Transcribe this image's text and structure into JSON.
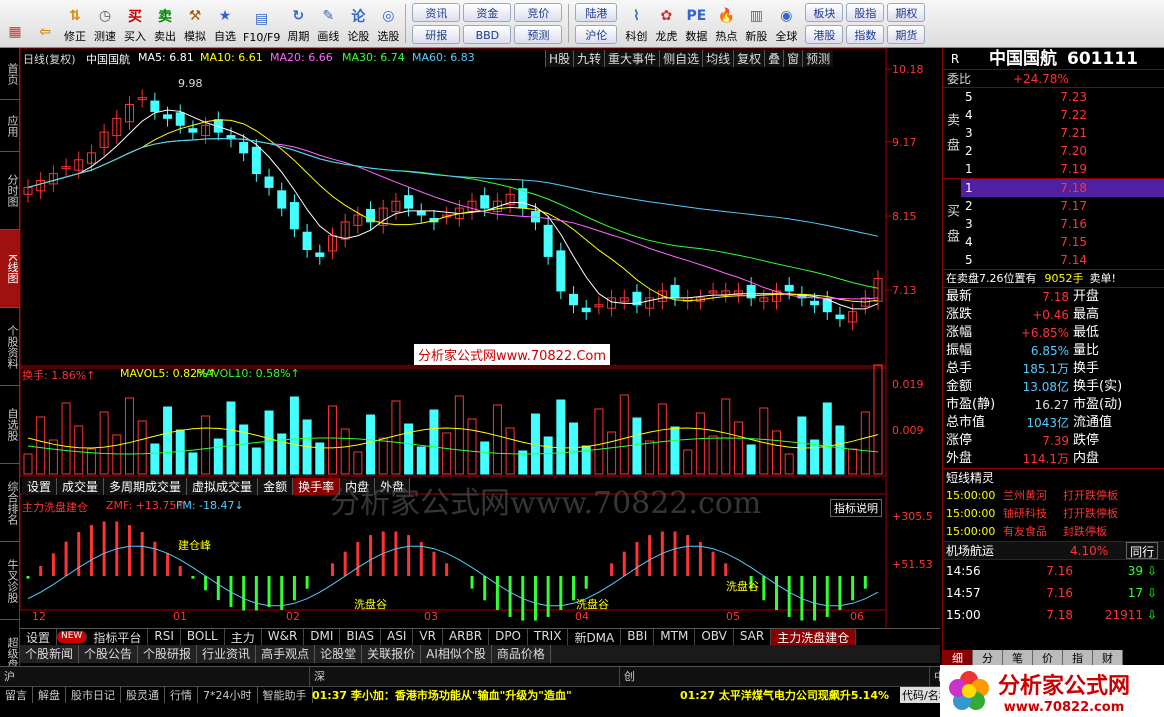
{
  "toolbar": {
    "buttons": [
      {
        "label": "",
        "icon": "grid-icon",
        "color": "#c33"
      },
      {
        "label": "",
        "icon": "back-arrow-icon",
        "color": "#d80"
      },
      {
        "label": "修正",
        "icon": "up-down-icon",
        "color": "#d80"
      },
      {
        "label": "测速",
        "icon": "clock-icon",
        "color": "#555"
      },
      {
        "label": "买入",
        "icon": "buy-icon",
        "color": "#c00"
      },
      {
        "label": "卖出",
        "icon": "sell-icon",
        "color": "#080"
      },
      {
        "label": "模拟",
        "icon": "hammer-icon",
        "color": "#a50"
      },
      {
        "label": "自选",
        "icon": "star-icon",
        "color": "#36c"
      },
      {
        "label": "F10/F9",
        "icon": "f10-icon",
        "color": "#36c"
      },
      {
        "label": "周期",
        "icon": "cycle-icon",
        "color": "#36c"
      },
      {
        "label": "画线",
        "icon": "pen-icon",
        "color": "#36c"
      },
      {
        "label": "论股",
        "icon": "discuss-icon",
        "color": "#36c"
      },
      {
        "label": "选股",
        "icon": "select-icon",
        "color": "#36c"
      }
    ],
    "pills1": [
      "资讯",
      "资金",
      "竞价",
      "研报",
      "BBD",
      "预测"
    ],
    "pills2": [
      "陆港",
      "沪伦"
    ],
    "buttons2": [
      {
        "label": "科创",
        "icon": "chart-icon",
        "color": "#36c"
      },
      {
        "label": "龙虎",
        "icon": "dragon-icon",
        "color": "#c33"
      },
      {
        "label": "数据",
        "icon": "pe-icon",
        "color": "#36c"
      },
      {
        "label": "热点",
        "icon": "hot-icon",
        "color": "#c33"
      },
      {
        "label": "新股",
        "icon": "ipo-icon",
        "color": "#36c"
      },
      {
        "label": "全球",
        "icon": "globe-icon",
        "color": "#36c"
      }
    ],
    "pills3": [
      "板块",
      "股指",
      "期权",
      "港股",
      "指数",
      "期货"
    ]
  },
  "left_tabs": [
    {
      "label": "首页",
      "active": false
    },
    {
      "label": "应用",
      "active": false
    },
    {
      "label": "分时图",
      "active": false
    },
    {
      "label": "K线图",
      "active": true
    },
    {
      "label": "个股资料",
      "active": false
    },
    {
      "label": "自选股",
      "active": false
    },
    {
      "label": "综合排名",
      "active": false
    },
    {
      "label": "牛叉诊股",
      "active": false
    },
    {
      "label": "超级盘口",
      "active": false
    }
  ],
  "chart": {
    "header": {
      "period": "日线(复权)",
      "name": "中国国航",
      "ma5": "MA5: 6.81",
      "ma10": "MA10: 6.61",
      "ma20": "MA20: 6.66",
      "ma30": "MA30: 6.74",
      "ma60": "MA60: 6.83"
    },
    "top_tabs": [
      "H股",
      "九转",
      "重大事件",
      "侧自选",
      "均线",
      "复权",
      "叠",
      "窗",
      "预测"
    ],
    "price_axis": [
      "10.18",
      "9.17",
      "8.15",
      "7.13"
    ],
    "high_mark": "9.98",
    "low_mark": "6.25",
    "watermark_center": "分析家公式网www.70822.Com",
    "vol_header": {
      "a": "换手: 1.86%↑",
      "b": "MAVOL5: 0.82%↑",
      "c": "MAVOL10: 0.58%↑"
    },
    "vol_axis": [
      "0.019",
      "0.009"
    ],
    "vol_tabs": [
      "设置",
      "成交量",
      "多周期成交量",
      "虚拟成交量",
      "金额",
      "换手率",
      "内盘",
      "外盘"
    ],
    "vol_tab_active": "换手率",
    "ind_header": {
      "name": "主力洗盘建仓",
      "zmf": "ZMF: +13.75↑",
      "fm": "FM: -18.47↓",
      "help": "指标说明"
    },
    "ind_axis": [
      "+305.5",
      "+51.53"
    ],
    "ind_labels": {
      "peak": "建仓峰",
      "valley1": "洗盘谷",
      "valley2": "洗盘谷",
      "valley3": "洗盘谷"
    },
    "watermark_big": "分析家公式网www.70822.com",
    "months": [
      "12",
      "01",
      "02",
      "03",
      "04",
      "05",
      "06"
    ]
  },
  "chart_data": {
    "type": "candlestick",
    "price_range": [
      6.0,
      10.2
    ],
    "close": [
      8.5,
      8.6,
      8.7,
      8.8,
      8.9,
      9.0,
      9.3,
      9.5,
      9.7,
      9.8,
      9.6,
      9.5,
      9.4,
      9.3,
      9.4,
      9.3,
      9.2,
      9.0,
      8.7,
      8.5,
      8.2,
      7.9,
      7.6,
      7.5,
      7.8,
      8.0,
      8.1,
      8.0,
      8.2,
      8.3,
      8.2,
      8.1,
      8.0,
      8.1,
      8.2,
      8.3,
      8.2,
      8.3,
      8.4,
      8.2,
      8.0,
      7.5,
      7.0,
      6.8,
      6.7,
      6.8,
      6.9,
      6.9,
      6.8,
      6.9,
      7.0,
      6.9,
      6.9,
      6.9,
      7.0,
      7.0,
      7.0,
      6.9,
      6.9,
      7.0,
      7.0,
      6.9,
      6.8,
      6.7,
      6.6,
      6.7,
      6.9,
      7.18
    ]
  },
  "quote": {
    "name": "中国国航",
    "code": "601111",
    "tag": "R",
    "weibi_label": "委比",
    "weibi": "+24.78%",
    "sell_label": "卖盘",
    "buy_label": "买盘",
    "sell": [
      {
        "n": "5",
        "p": "7.23"
      },
      {
        "n": "4",
        "p": "7.22"
      },
      {
        "n": "3",
        "p": "7.21"
      },
      {
        "n": "2",
        "p": "7.20"
      },
      {
        "n": "1",
        "p": "7.19"
      }
    ],
    "buy": [
      {
        "n": "1",
        "p": "7.18"
      },
      {
        "n": "2",
        "p": "7.17"
      },
      {
        "n": "3",
        "p": "7.16"
      },
      {
        "n": "4",
        "p": "7.15"
      },
      {
        "n": "5",
        "p": "7.14"
      }
    ],
    "order_note": "在卖盘7.26位置有",
    "order_qty": "9052手",
    "order_side": "卖单!",
    "stats": [
      {
        "k": "最新",
        "v": "7.18",
        "k2": "开盘",
        "c": "#f33"
      },
      {
        "k": "涨跌",
        "v": "+0.46",
        "k2": "最高",
        "c": "#f33"
      },
      {
        "k": "涨幅",
        "v": "+6.85%",
        "k2": "最低",
        "c": "#f33"
      },
      {
        "k": "振幅",
        "v": "6.85%",
        "k2": "量比",
        "c": "#5cf"
      },
      {
        "k": "总手",
        "v": "185.1万",
        "k2": "换手",
        "c": "#5cf"
      },
      {
        "k": "金额",
        "v": "13.08亿",
        "k2": "换手(实)",
        "c": "#5cf"
      },
      {
        "k": "市盈(静)",
        "v": "16.27",
        "k2": "市盈(动)",
        "c": "#ddd"
      },
      {
        "k": "总市值",
        "v": "1043亿",
        "k2": "流通值",
        "c": "#5cf"
      },
      {
        "k": "涨停",
        "v": "7.39",
        "k2": "跌停",
        "c": "#f33"
      },
      {
        "k": "外盘",
        "v": "114.1万",
        "k2": "内盘",
        "c": "#f33"
      }
    ],
    "news_title": "短线精灵",
    "news": [
      {
        "t": "15:00:00",
        "name": "兰州黄河",
        "ev": "打开跌停板"
      },
      {
        "t": "15:00:00",
        "name": "铀研科技",
        "ev": "打开跌停板"
      },
      {
        "t": "15:00:00",
        "name": "有友食品",
        "ev": "封跌停板"
      }
    ],
    "sector": "机场航运",
    "sector_pct": "4.10%",
    "sector_tab": "同行",
    "ticks": [
      {
        "t": "14:56",
        "p": "7.16",
        "v": "39",
        "dir": "down"
      },
      {
        "t": "14:57",
        "p": "7.16",
        "v": "17",
        "dir": "down"
      },
      {
        "t": "15:00",
        "p": "7.18",
        "v": "21911",
        "dir": "down"
      }
    ],
    "bottom_tabs": [
      "细",
      "分",
      "笔",
      "价",
      "指",
      "财"
    ]
  },
  "indicator_tabs": [
    "设置",
    "NEW",
    "指标平台",
    "RSI",
    "BOLL",
    "主力",
    "W&R",
    "DMI",
    "BIAS",
    "ASI",
    "VR",
    "ARBR",
    "DPO",
    "TRIX",
    "新DMA",
    "BBI",
    "MTM",
    "OBV",
    "SAR",
    "主力洗盘建仓"
  ],
  "info_tabs": [
    "个股新闻",
    "个股公告",
    "个股研报",
    "行业资讯",
    "高手观点",
    "论股堂",
    "关联报价",
    "AI相似个股",
    "商品价格"
  ],
  "markets": [
    "沪",
    "深",
    "创",
    "中小"
  ],
  "status": {
    "items": [
      "留言",
      "解盘",
      "股市日记",
      "股灵通",
      "行情",
      "7*24小时",
      "智能助手"
    ],
    "news1": "01:37 李小加：香港市场功能从\"输血\"升级为\"造血\"",
    "news2": "01:27 太平洋煤气电力公司现飙升5.14%",
    "code_label": "代码/名称"
  },
  "logo": {
    "text": "分析家公式网",
    "url": "www.70822.com"
  }
}
